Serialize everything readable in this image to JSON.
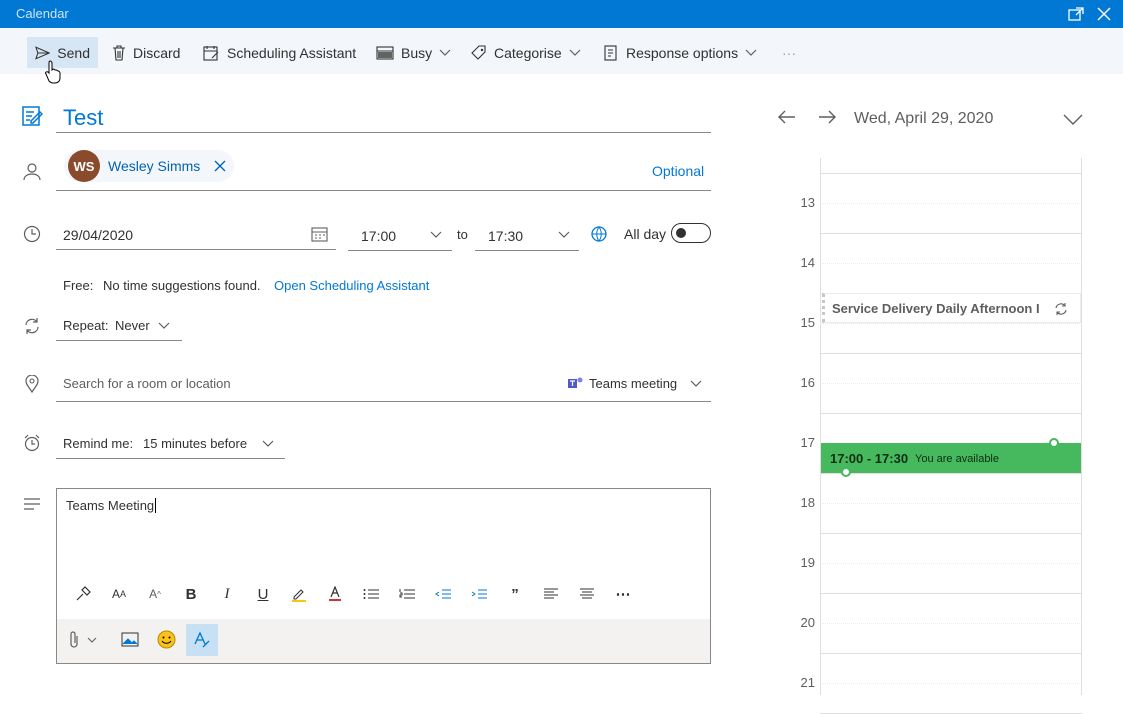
{
  "window": {
    "title": "Calendar"
  },
  "toolbar": {
    "send": "Send",
    "discard": "Discard",
    "scheduling": "Scheduling Assistant",
    "busy": "Busy",
    "categorise": "Categorise",
    "response": "Response options",
    "more": "···"
  },
  "event": {
    "title": "Test",
    "attendee_initials": "WS",
    "attendee_name": "Wesley Simms",
    "optional": "Optional",
    "date": "29/04/2020",
    "start": "17:00",
    "to": "to",
    "end": "17:30",
    "all_day": "All day",
    "free_label": "Free:",
    "free_msg": "No time suggestions found.",
    "open_sched": "Open Scheduling Assistant",
    "repeat": "Repeat:",
    "repeat_val": "Never",
    "location_placeholder": "Search for a room or location",
    "teams": "Teams meeting",
    "remind": "Remind me:",
    "remind_val": "15 minutes before",
    "body": "Teams Meeting"
  },
  "calendar": {
    "date": "Wed, April 29, 2020",
    "hours": [
      "13",
      "14",
      "15",
      "16",
      "17",
      "18",
      "19",
      "20",
      "21"
    ],
    "existing_event": "Service Delivery Daily Afternoon I",
    "new_event_time": "17:00 - 17:30",
    "new_event_status": "You are available",
    "new_event_color": "#46b95e"
  },
  "colors": {
    "accent": "#0078d4",
    "link": "#0078d4"
  }
}
